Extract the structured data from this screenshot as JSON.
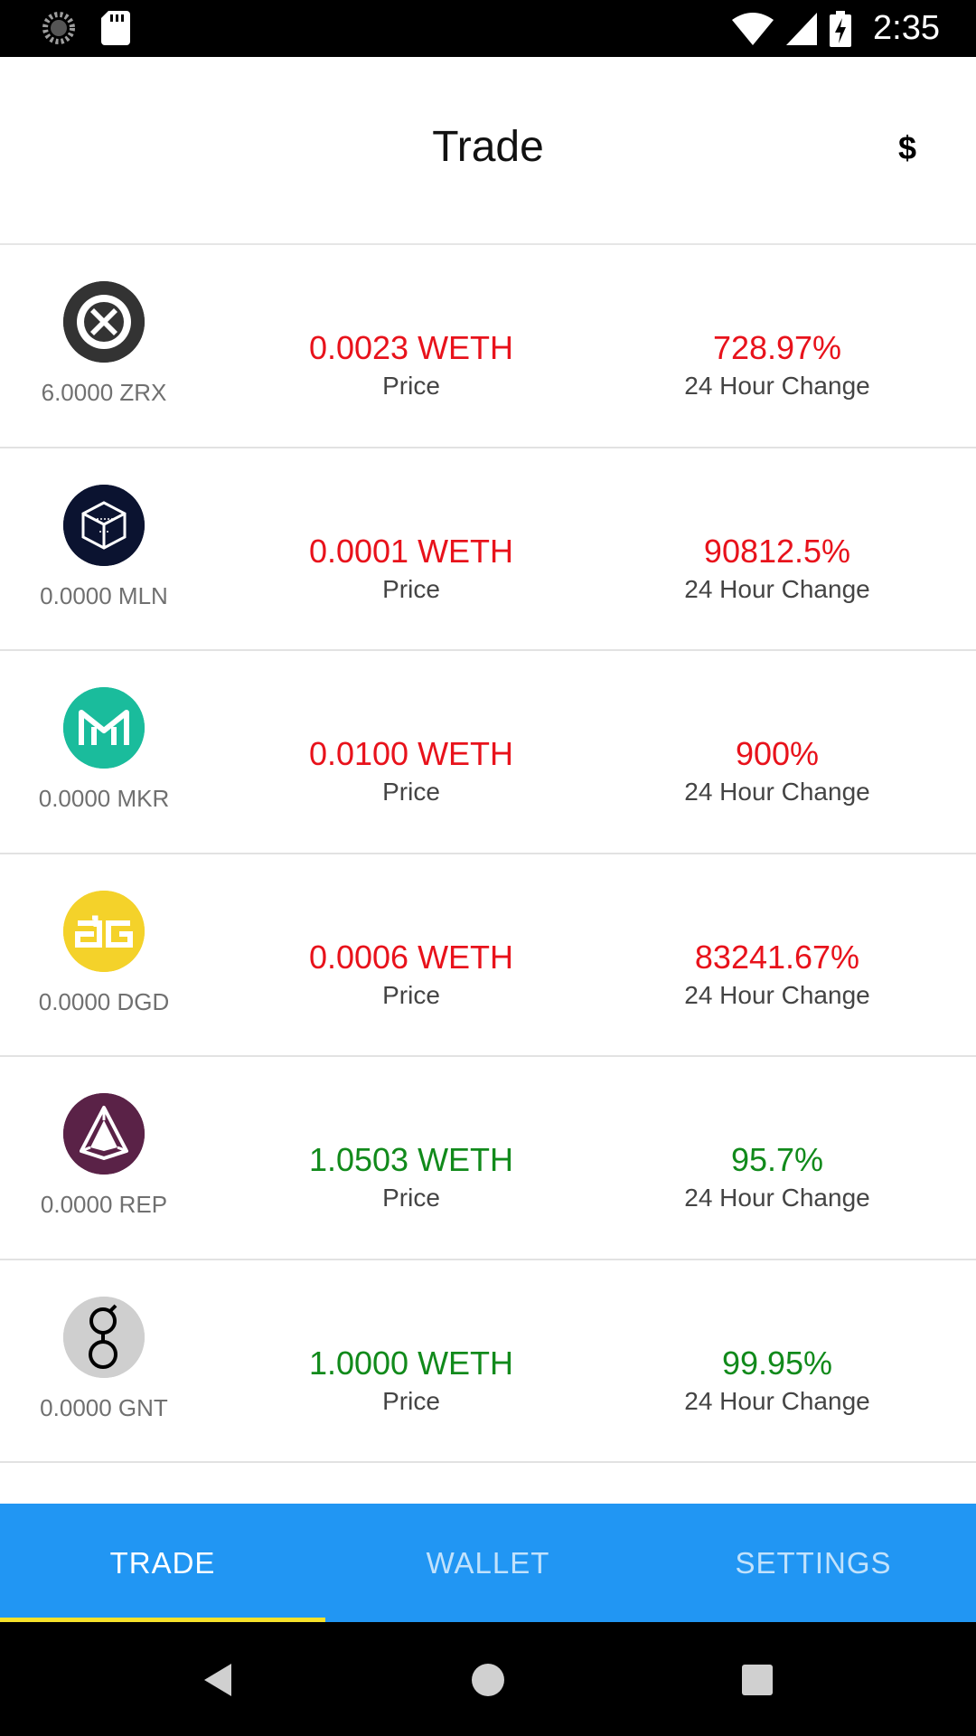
{
  "status_bar": {
    "time": "2:35",
    "icons": [
      "loading-icon",
      "sd-card-icon",
      "wifi-icon",
      "cell-signal-icon",
      "battery-charging-icon"
    ]
  },
  "header": {
    "title": "Trade",
    "currency_symbol": "$"
  },
  "tokens": [
    {
      "symbol": "ZRX",
      "amount": "6.0000 ZRX",
      "price": "0.0023 WETH",
      "price_label": "Price",
      "change": "728.97%",
      "change_label": "24 Hour Change",
      "trend": "down",
      "icon": "zrx-logo-icon",
      "icon_bg": "#333333"
    },
    {
      "symbol": "MLN",
      "amount": "0.0000 MLN",
      "price": "0.0001 WETH",
      "price_label": "Price",
      "change": "90812.5%",
      "change_label": "24 Hour Change",
      "trend": "down",
      "icon": "mln-logo-icon",
      "icon_bg": "#0b1330"
    },
    {
      "symbol": "MKR",
      "amount": "0.0000 MKR",
      "price": "0.0100 WETH",
      "price_label": "Price",
      "change": "900%",
      "change_label": "24 Hour Change",
      "trend": "down",
      "icon": "mkr-logo-icon",
      "icon_bg": "#1abc9c"
    },
    {
      "symbol": "DGD",
      "amount": "0.0000 DGD",
      "price": "0.0006 WETH",
      "price_label": "Price",
      "change": "83241.67%",
      "change_label": "24 Hour Change",
      "trend": "down",
      "icon": "dgd-logo-icon",
      "icon_bg": "#f4d22a"
    },
    {
      "symbol": "REP",
      "amount": "0.0000 REP",
      "price": "1.0503 WETH",
      "price_label": "Price",
      "change": "95.7%",
      "change_label": "24 Hour Change",
      "trend": "up",
      "icon": "rep-logo-icon",
      "icon_bg": "#5a2247"
    },
    {
      "symbol": "GNT",
      "amount": "0.0000 GNT",
      "price": "1.0000 WETH",
      "price_label": "Price",
      "change": "99.95%",
      "change_label": "24 Hour Change",
      "trend": "up",
      "icon": "gnt-logo-icon",
      "icon_bg": "#cfcfcf"
    }
  ],
  "tabs": [
    {
      "label": "TRADE",
      "active": true
    },
    {
      "label": "WALLET",
      "active": false
    },
    {
      "label": "SETTINGS",
      "active": false
    }
  ],
  "colors": {
    "accent": "#2196f3",
    "tab_indicator": "#f6e12a",
    "negative": "#e8121b",
    "positive": "#118a1b"
  },
  "nav_bar": {
    "buttons": [
      "back-icon",
      "home-icon",
      "recents-icon"
    ]
  }
}
